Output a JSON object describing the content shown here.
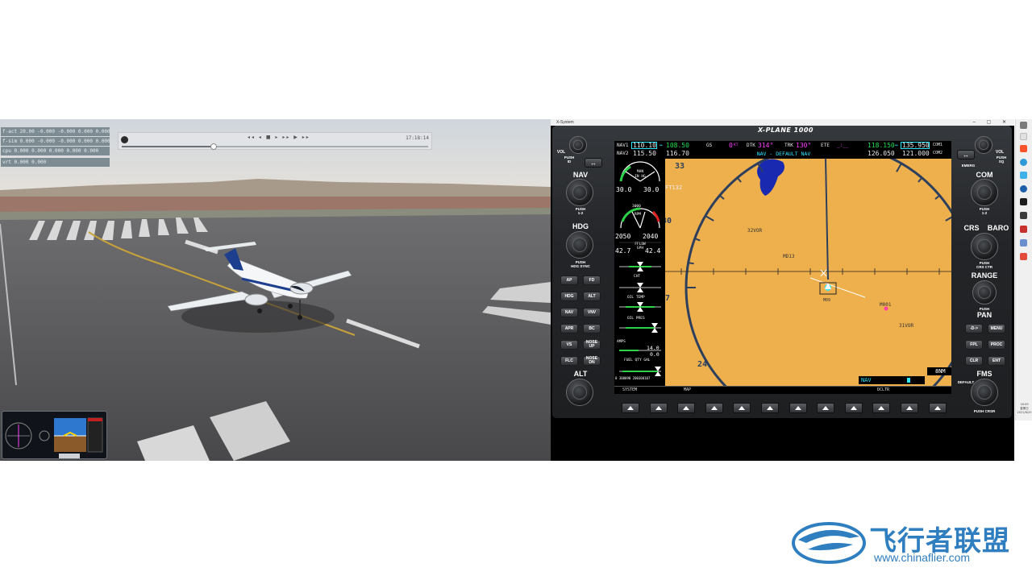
{
  "sim": {
    "data_rows": [
      "f-act 20.00  -0.000 -0.000 0.000 0.000",
      "f-sim 0.000  -0.000 -0.000 0.000 0.000",
      "cpu  0.000   0.000 0.000 0.000 0.000",
      "vrt 0.000  0.000"
    ],
    "replay": {
      "controls": "◂◂ ◂ ■ ▸ ▸▸ ▶ ▸▸",
      "time": "17:18:14",
      "progress": 0.3
    }
  },
  "window": {
    "title": "X-System"
  },
  "g1000": {
    "title": "X-PLANE 1000",
    "left_controls": {
      "vol_label": "VOL",
      "vol_push": "PUSH\nID",
      "nav_label": "NAV",
      "nav_push": "PUSH\n1-2",
      "hdg_label": "HDG",
      "hdg_push": "PUSH\nHDG SYNC",
      "alt_label": "ALT",
      "buttons": [
        "AP",
        "FD",
        "HDG",
        "ALT",
        "NAV",
        "VNV",
        "APR",
        "BC",
        "VS",
        "NOSE UP",
        "FLC",
        "NOSE DN"
      ]
    },
    "right_controls": {
      "vol_label": "VOL",
      "vol_push": "PUSH\nSQ",
      "emerg": "EMERG",
      "com_label": "COM",
      "com_push": "PUSH\n1-2",
      "crs_label": "CRS",
      "baro_label": "BARO",
      "crs_push": "PUSH\nCRS CTR",
      "range_label": "RANGE",
      "pan_push": "PUSH",
      "pan_label": "PAN",
      "buttons": [
        "-D->",
        "MENU",
        "FPL",
        "PROC",
        "CLR",
        "ENT"
      ],
      "fms_label": "FMS",
      "default_label": "DEFAULT",
      "push_crsr": "PUSH CRSR"
    },
    "nav_bar": {
      "nav1_label": "NAV1",
      "nav1_active": "110.10",
      "nav1_standby": "108.50",
      "nav2_label": "NAV2",
      "nav2_active": "115.50",
      "nav2_standby": "116.70",
      "gs_label": "GS",
      "gs_value": "0",
      "gs_unit": "KT",
      "dtk_label": "DTK",
      "dtk_value": "314°",
      "trk_label": "TRK",
      "trk_value": "130°",
      "ete_label": "ETE",
      "ete_value": "_:__",
      "com1_active": "118.150",
      "com1_standby": "135.950",
      "com1_label": "COM1",
      "com2_active": "126.050",
      "com2_standby": "121.000",
      "com2_label": "COM2",
      "page_title": "NAV - DEFAULT NAV",
      "swap": "↔"
    },
    "eis": {
      "man_label": "MAN\nIN HG",
      "man_l": "30.0",
      "man_r": "30.0",
      "rpm_label": "RPM",
      "rpm_l": "2050",
      "rpm_r": "2040",
      "rpm_scale": "3000",
      "ffow_label": "FFLOW\nGPH",
      "ffow_l": "42.7",
      "ffow_r": "42.4",
      "cht_label": "CHT",
      "oil_temp_label": "OIL TEMP",
      "oil_pres_label": "OIL PRES",
      "amps_label": "AMPS",
      "amps_value": "14.0",
      "volts_value": "0.0",
      "fuel_label": "FUEL QTY GAL",
      "fuel_scale": "0 300090 200300107"
    },
    "map": {
      "heading_labels": [
        "33",
        "30",
        "27",
        "24"
      ],
      "waypoints": [
        "FT132",
        "32VOR",
        "MD13",
        "M001",
        "31VOR",
        "M09"
      ],
      "nav_tag": "NAV",
      "range_tag": "8NM",
      "colors": {
        "ground": "#eeb04d",
        "water": "#1a2ab0",
        "compass": "#2d3f5c"
      }
    },
    "softkeys": {
      "labels": [
        "SYSTEM",
        "MAP",
        "DCLTR"
      ],
      "count": 12
    }
  },
  "taskbar": {
    "clock_time": "16:09",
    "clock_day": "星期日",
    "clock_date": "2021/6/20"
  },
  "watermark": {
    "brand": "飞行者联盟",
    "url": "www.chinaflier.com"
  }
}
